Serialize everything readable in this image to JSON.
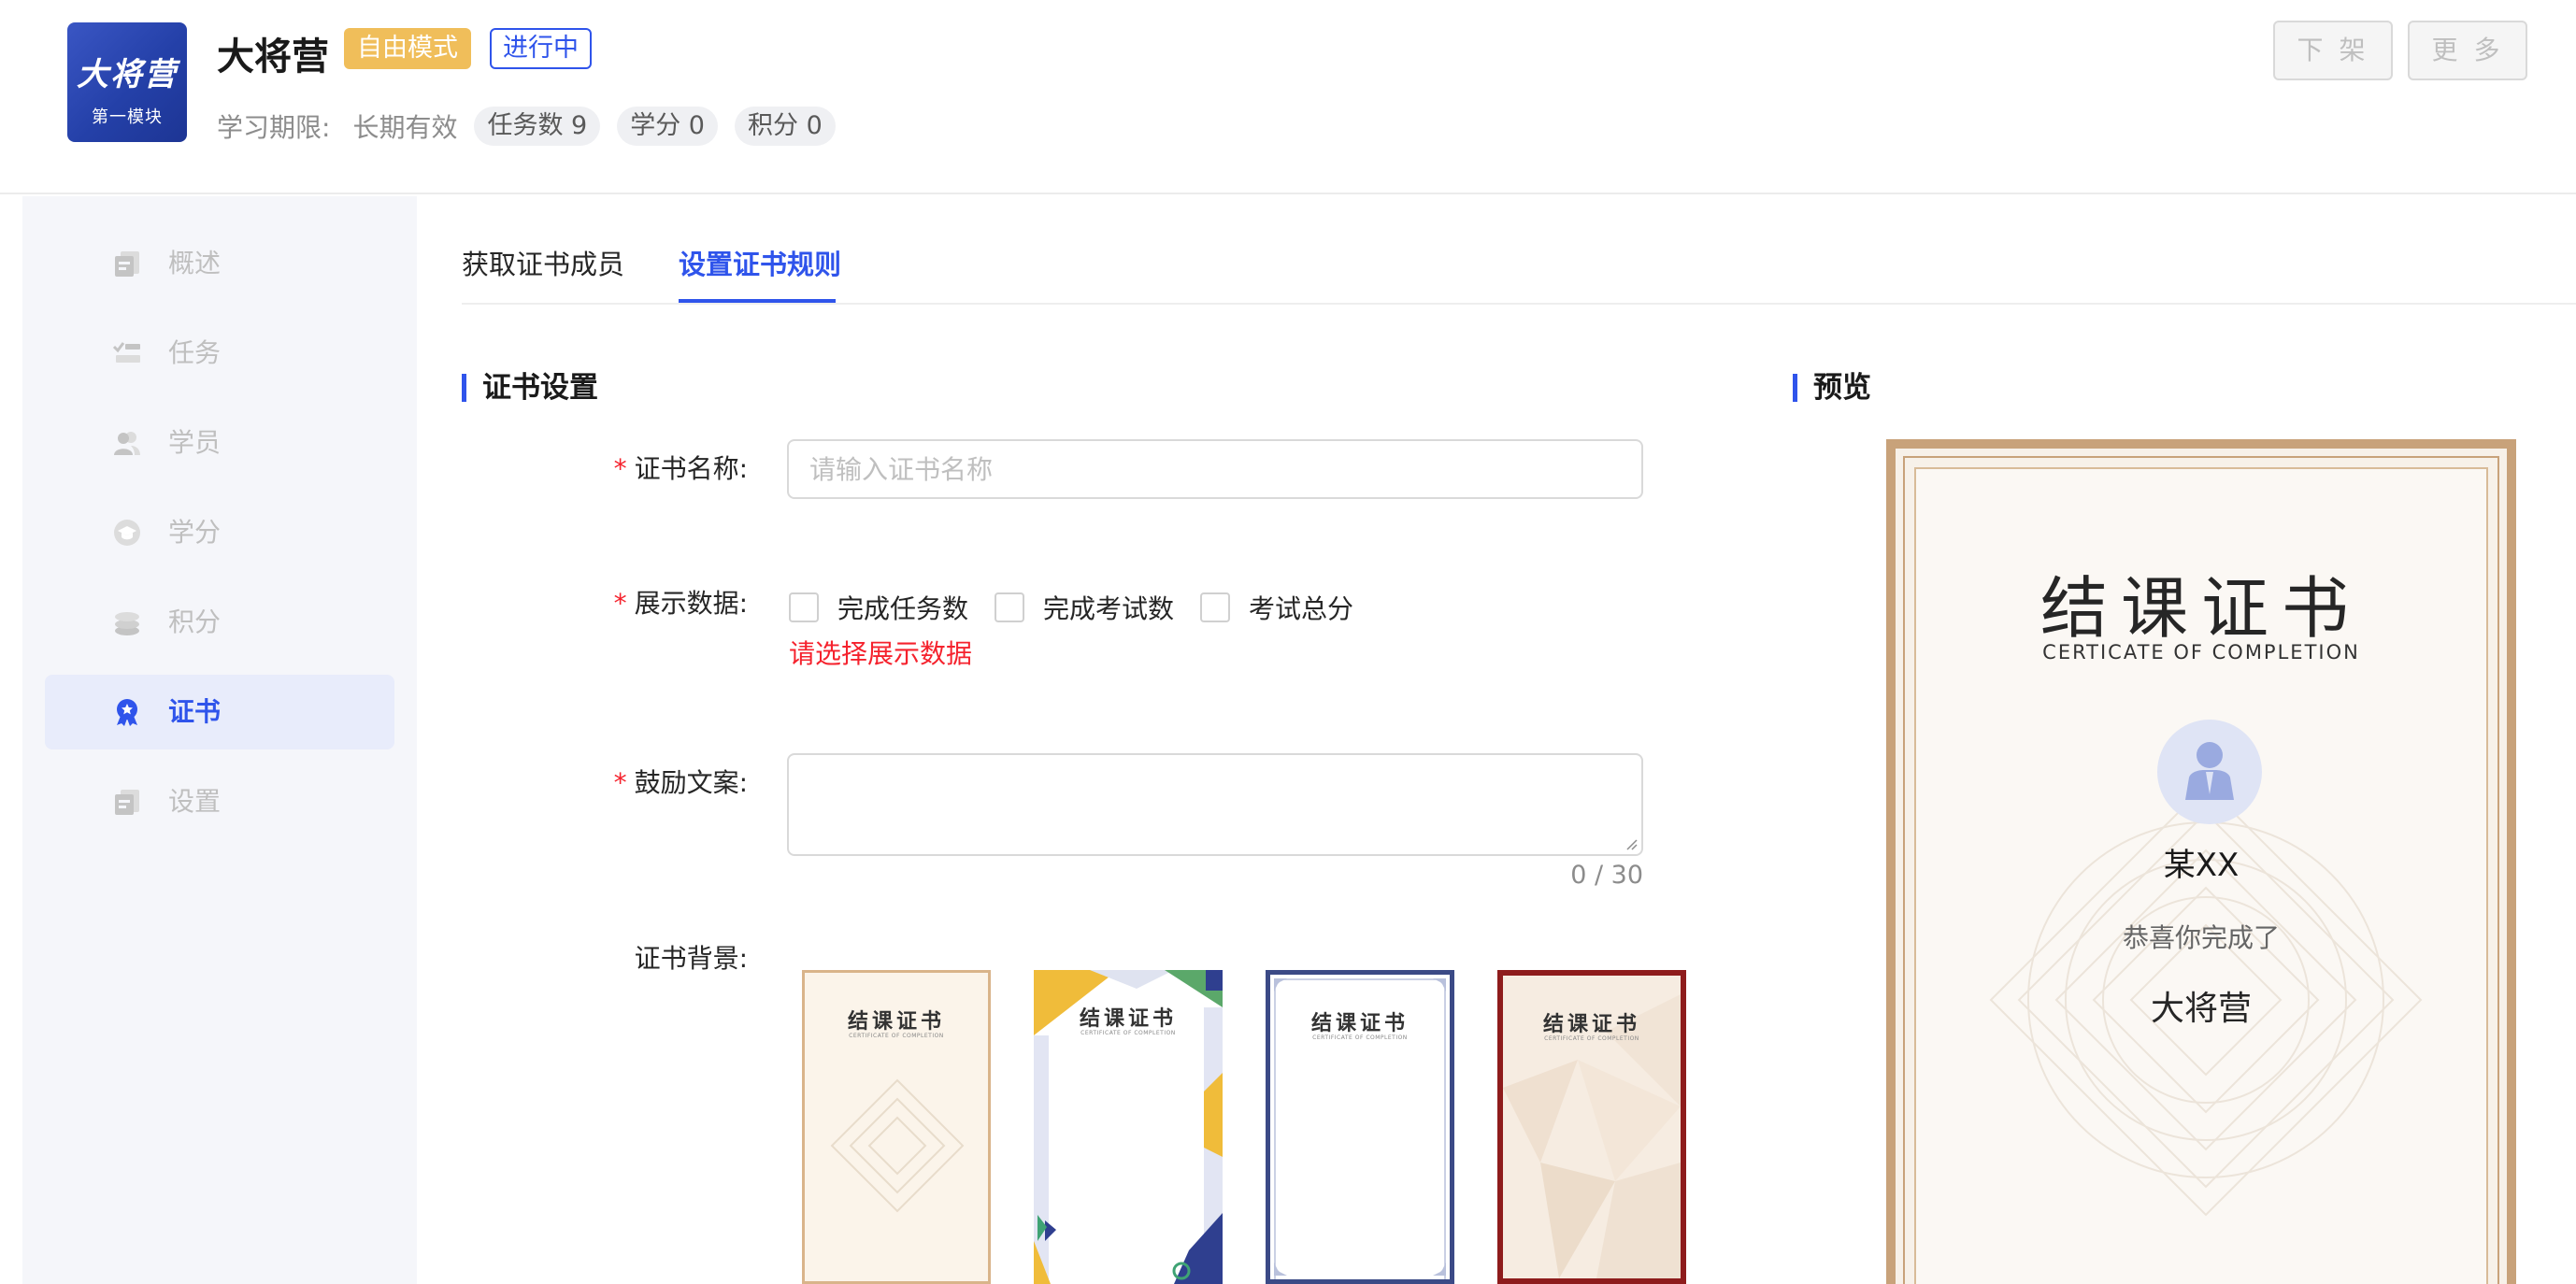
{
  "header": {
    "logo": {
      "line1": "大将营",
      "line2": "第一模块"
    },
    "title": "大将营",
    "mode_tag": "自由模式",
    "status_tag": "进行中",
    "period_label": "学习期限:",
    "period_value": "长期有效",
    "pills": [
      "任务数 9",
      "学分 0",
      "积分 0"
    ],
    "buttons": {
      "offline": "下 架",
      "more": "更 多"
    }
  },
  "sidebar": {
    "items": [
      {
        "label": "概述",
        "icon": "overview-icon",
        "active": false
      },
      {
        "label": "任务",
        "icon": "task-icon",
        "active": false
      },
      {
        "label": "学员",
        "icon": "students-icon",
        "active": false
      },
      {
        "label": "学分",
        "icon": "credit-icon",
        "active": false
      },
      {
        "label": "积分",
        "icon": "points-icon",
        "active": false
      },
      {
        "label": "证书",
        "icon": "certificate-icon",
        "active": true
      },
      {
        "label": "设置",
        "icon": "settings-icon",
        "active": false
      }
    ]
  },
  "tabs": [
    {
      "label": "获取证书成员",
      "active": false
    },
    {
      "label": "设置证书规则",
      "active": true
    }
  ],
  "form": {
    "section_title": "证书设置",
    "name_label": "证书名称:",
    "name_placeholder": "请输入证书名称",
    "name_value": "",
    "display_label": "展示数据:",
    "display_options": [
      {
        "label": "完成任务数",
        "checked": false
      },
      {
        "label": "完成考试数",
        "checked": false
      },
      {
        "label": "考试总分",
        "checked": false
      }
    ],
    "display_error": "请选择展示数据",
    "encourage_label": "鼓励文案:",
    "encourage_value": "",
    "encourage_counter": "0 / 30",
    "background_label": "证书背景:",
    "background_thumbs": [
      {
        "title": "结课证书",
        "subtitle": "CERTIFICATE OF COMPLETION",
        "style": "gold"
      },
      {
        "title": "结课证书",
        "subtitle": "CERTIFICATE OF COMPLETION",
        "style": "geometric"
      },
      {
        "title": "结课证书",
        "subtitle": "CERTIFICATE OF COMPLETION",
        "style": "navy"
      },
      {
        "title": "结课证书",
        "subtitle": "CERTIFICATE OF COMPLETION",
        "style": "red"
      }
    ]
  },
  "preview": {
    "section_title": "预览",
    "cert_title": "结课证书",
    "cert_subtitle": "CERTICATE OF COMPLETION",
    "name": "某XX",
    "congrats": "恭喜你完成了",
    "course": "大将营"
  },
  "colors": {
    "accent": "#2f54eb",
    "mode_tag_bg": "#f0be5a",
    "error": "#f5222d",
    "cert_border": "#c8a27a"
  }
}
